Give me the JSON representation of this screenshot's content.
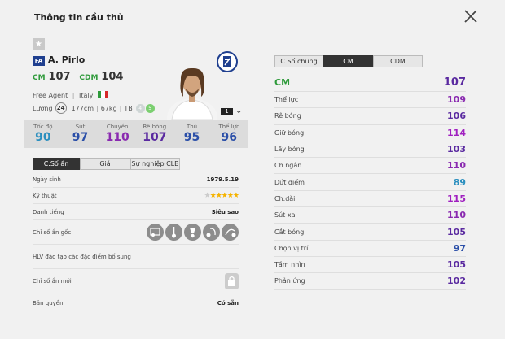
{
  "window": {
    "title": "Thông tin cầu thủ"
  },
  "player": {
    "season_badge": "FA",
    "name": "A. Pirlo",
    "positions": [
      {
        "code": "CM",
        "value": "107"
      },
      {
        "code": "CDM",
        "value": "104"
      }
    ],
    "team": "Free Agent",
    "nationality": "Italy",
    "salary_label": "Lương",
    "salary": "24",
    "height": "177cm",
    "weight": "67kg",
    "body_type": "TB",
    "left_foot": "4",
    "right_foot": "5",
    "upgrade_level": "1"
  },
  "summary_stats": [
    {
      "label": "Tốc độ",
      "value": "90",
      "color": "#2b8fbf"
    },
    {
      "label": "Sút",
      "value": "97",
      "color": "#2b4fa8"
    },
    {
      "label": "Chuyền",
      "value": "110",
      "color": "#8a2ab0"
    },
    {
      "label": "Rê bóng",
      "value": "107",
      "color": "#5a2aa0"
    },
    {
      "label": "Thủ",
      "value": "95",
      "color": "#2b4fa8"
    },
    {
      "label": "Thể lực",
      "value": "96",
      "color": "#2b4fa8"
    }
  ],
  "left_tabs": [
    "C.Số ẩn",
    "Giá",
    "Sự nghiệp CLB"
  ],
  "info_rows": {
    "birth_label": "Ngày sinh",
    "birth": "1979.5.19",
    "skill_label": "Kỹ thuật",
    "fame_label": "Danh tiếng",
    "fame": "Siêu sao",
    "traits_label": "Chỉ số ẩn gốc",
    "coach_label": "HLV đào tạo các đặc điểm bổ sung",
    "new_traits_label": "Chỉ số ẩn mới",
    "license_label": "Bản quyền",
    "license": "Có sẵn"
  },
  "skill_stars": {
    "filled": 5,
    "total": 6
  },
  "right_tabs": [
    "C.Số chung",
    "CM",
    "CDM"
  ],
  "detail_head": {
    "label": "CM",
    "value": "107",
    "color": "#5a2aa0"
  },
  "detail_stats": [
    {
      "label": "Thể lực",
      "value": "109",
      "color": "#8a2ab0"
    },
    {
      "label": "Rê bóng",
      "value": "106",
      "color": "#5a2aa0"
    },
    {
      "label": "Giữ bóng",
      "value": "114",
      "color": "#a020c0"
    },
    {
      "label": "Lấy bóng",
      "value": "103",
      "color": "#5a2aa0"
    },
    {
      "label": "Ch.ngắn",
      "value": "110",
      "color": "#8a2ab0"
    },
    {
      "label": "Dứt điểm",
      "value": "89",
      "color": "#2b8fbf"
    },
    {
      "label": "Ch.dài",
      "value": "115",
      "color": "#a020c0"
    },
    {
      "label": "Sút xa",
      "value": "110",
      "color": "#8a2ab0"
    },
    {
      "label": "Cắt bóng",
      "value": "105",
      "color": "#5a2aa0"
    },
    {
      "label": "Chọn vị trí",
      "value": "97",
      "color": "#2b4fa8"
    },
    {
      "label": "Tầm nhìn",
      "value": "105",
      "color": "#5a2aa0"
    },
    {
      "label": "Phản ứng",
      "value": "102",
      "color": "#5a2aa0"
    }
  ],
  "icons": [
    "close-icon",
    "favorite-star-icon",
    "club-logo-icon",
    "italy-flag-icon",
    "trait-icon",
    "lock-icon",
    "chevron-down-icon"
  ]
}
